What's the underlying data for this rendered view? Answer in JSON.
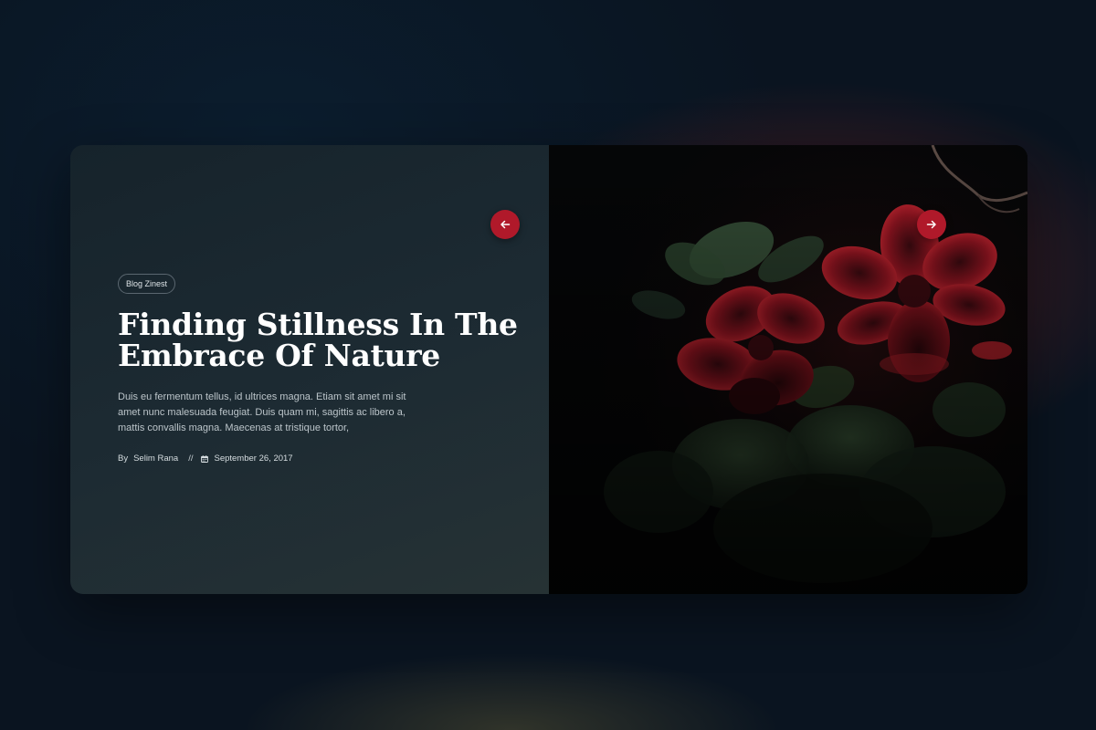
{
  "post": {
    "category": "Blog Zinest",
    "title": "Finding Stillness In The Embrace Of Nature",
    "excerpt": "Duis eu fermentum tellus, id ultrices magna. Etiam sit amet mi sit amet nunc malesuada feugiat. Duis quam mi, sagittis ac libero a, mattis convallis magna. Maecenas at tristique tortor,",
    "author_prefix": "By",
    "author": "Selim Rana",
    "separator": "//",
    "date": "September 26, 2017"
  },
  "slider": {
    "prev_icon": "arrow-left-icon",
    "next_icon": "arrow-right-icon",
    "accent_color": "#b0192a"
  },
  "icons": {
    "date_icon": "calendar-icon"
  }
}
